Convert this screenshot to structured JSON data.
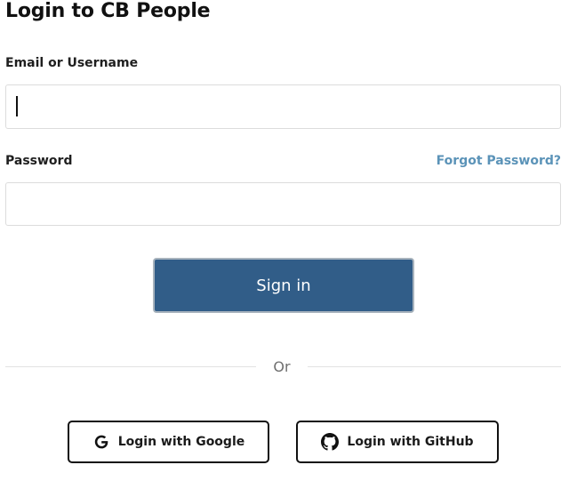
{
  "page": {
    "title": "Login to CB People"
  },
  "form": {
    "email_label": "Email or Username",
    "email_value": "",
    "password_label": "Password",
    "password_value": "",
    "forgot_password": "Forgot Password?",
    "submit_label": "Sign in"
  },
  "divider": {
    "text": "Or"
  },
  "oauth": {
    "google": {
      "label": "Login with Google",
      "icon": "google-icon"
    },
    "github": {
      "label": "Login with GitHub",
      "icon": "github-icon"
    }
  },
  "colors": {
    "primary": "#315d88",
    "link": "#5b93b8",
    "border": "#dcdcdc"
  }
}
